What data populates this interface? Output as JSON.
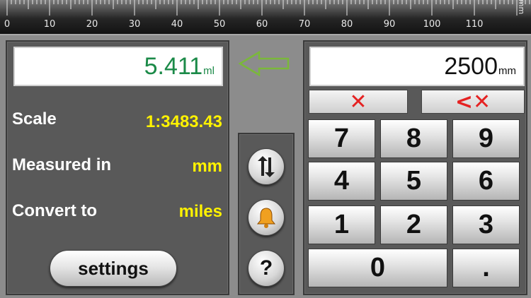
{
  "ruler": {
    "unit": "mm",
    "labels": [
      "0",
      "10",
      "20",
      "30",
      "40",
      "50",
      "60",
      "70",
      "80",
      "90",
      "100",
      "110"
    ]
  },
  "result": {
    "value": "5.411",
    "unit": "ml"
  },
  "input": {
    "value": "2500",
    "unit": "mm"
  },
  "info": {
    "scale_label": "Scale",
    "scale_value": "1:3483.43",
    "measured_label": "Measured in",
    "measured_value": "mm",
    "convert_label": "Convert to",
    "convert_value": "miles"
  },
  "settings_label": "settings",
  "help_label": "?",
  "keypad": {
    "clear_label": "✕",
    "backspace_label": "<✕",
    "keys": [
      "7",
      "8",
      "9",
      "4",
      "5",
      "6",
      "1",
      "2",
      "3",
      "0",
      "."
    ]
  },
  "colors": {
    "result_text": "#1b8a48",
    "info_value": "#fff200",
    "clear_red": "#e52222",
    "arrow_green": "#7ab83a"
  },
  "icons": {
    "arrow": "left-arrow-icon",
    "swap": "swap-icon",
    "sound": "bell-icon",
    "help": "question-icon"
  }
}
